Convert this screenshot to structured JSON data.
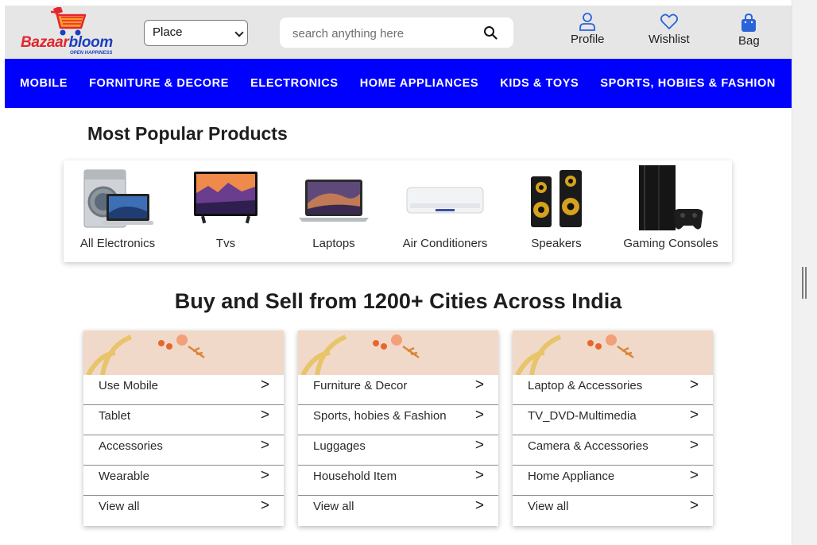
{
  "brand": {
    "name_part1": "Bazaar",
    "name_part2": "bloom",
    "tagline": "OPEN HAPPINESS"
  },
  "header": {
    "place_select": {
      "selected": "Place"
    },
    "search": {
      "placeholder": "search anything here"
    },
    "icons": [
      {
        "label": "Profile",
        "icon": "user-icon"
      },
      {
        "label": "Wishlist",
        "icon": "heart-icon"
      },
      {
        "label": "Bag",
        "icon": "bag-icon"
      }
    ]
  },
  "nav": {
    "items": [
      "MOBILE",
      "FORNITURE & DECORE",
      "ELECTRONICS",
      "HOME APPLIANCES",
      "KIDS & TOYS",
      "SPORTS, HOBIES & FASHION"
    ]
  },
  "popular": {
    "title": "Most Popular Products",
    "items": [
      {
        "label": "All Electronics",
        "icon": "washing-machine-laptop-image"
      },
      {
        "label": "Tvs",
        "icon": "tv-image"
      },
      {
        "label": "Laptops",
        "icon": "laptop-image"
      },
      {
        "label": "Air Conditioners",
        "icon": "air-conditioner-image"
      },
      {
        "label": "Speakers",
        "icon": "speakers-image"
      },
      {
        "label": "Gaming Consoles",
        "icon": "gaming-console-image"
      }
    ]
  },
  "cities": {
    "title": "Buy and Sell from 1200+ Cities Across India"
  },
  "categories": [
    {
      "rows": [
        "Use Mobile",
        "Tablet",
        "Accessories",
        "Wearable",
        "View all"
      ]
    },
    {
      "rows": [
        "Furniture & Decor",
        "Sports, hobies & Fashion",
        "Luggages",
        "Household Item",
        "View all"
      ]
    },
    {
      "rows": [
        "Laptop & Accessories",
        "TV_DVD-Multimedia",
        "Camera & Accessories",
        "Home Appliance",
        "View all"
      ]
    }
  ],
  "arrow_glyph": ">",
  "colors": {
    "nav_bg": "#0000ff",
    "header_bg": "#e6e6e6",
    "brand_red": "#e3262c",
    "brand_blue": "#1a3fc0",
    "icon_blue": "#2b63d9"
  }
}
